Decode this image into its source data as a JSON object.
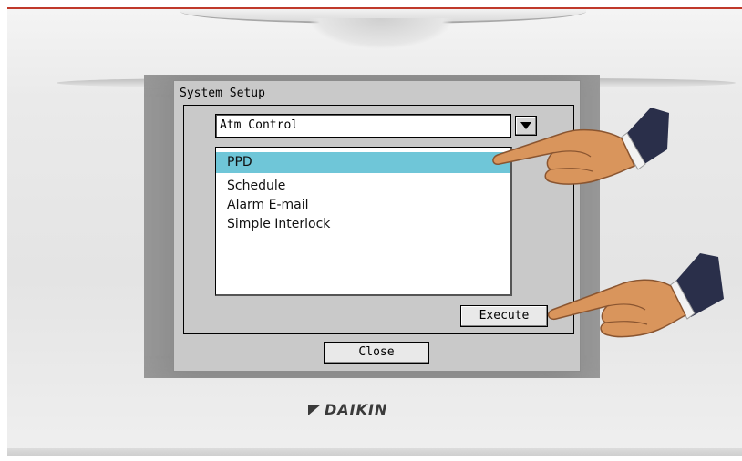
{
  "screen": {
    "title": "System Setup",
    "dropdown": {
      "value": "Atm Control"
    },
    "list": {
      "items": [
        "PPD",
        "Schedule",
        "Alarm E-mail",
        "Simple Interlock"
      ],
      "selected_index": 0
    },
    "buttons": {
      "execute": "Execute",
      "close": "Close"
    }
  },
  "brand": {
    "name": "DAIKIN"
  },
  "colors": {
    "selection": "#6fc6d8",
    "screen_bg": "#c9c9c9",
    "accent_line": "#c0392b"
  },
  "icons": [
    "dropdown-arrow-icon",
    "pointing-hand-icon",
    "daikin-logo-icon"
  ]
}
